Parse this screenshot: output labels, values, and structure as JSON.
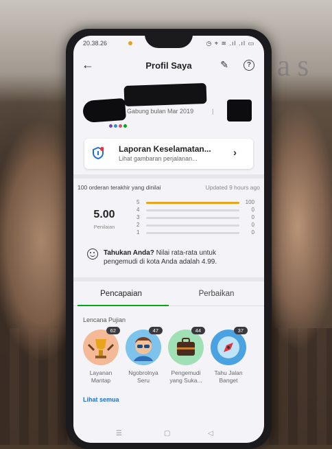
{
  "status": {
    "time": "20.38.26",
    "icons": "◷ ⌖ ≋ .ıl .ıl ▭"
  },
  "header": {
    "title": "Profil Saya",
    "back_icon": "←",
    "edit_icon": "✎",
    "help_icon": "?"
  },
  "profile": {
    "joined": "Gabung bulan Mar 2019",
    "separator": "|"
  },
  "safety_report": {
    "title": "Laporan Keselamatan...",
    "subtitle": "Lihat gambaran perjalanan...",
    "chevron": "›"
  },
  "ratings": {
    "header": "100 orderan terakhir yang dinilai",
    "updated": "Updated 9 hours ago",
    "score": "5.00",
    "score_label": "Penilaian",
    "distribution": [
      {
        "stars": "5",
        "count": "100",
        "fraction": 1.0
      },
      {
        "stars": "4",
        "count": "0",
        "fraction": 0
      },
      {
        "stars": "3",
        "count": "0",
        "fraction": 0
      },
      {
        "stars": "2",
        "count": "0",
        "fraction": 0
      },
      {
        "stars": "1",
        "count": "0",
        "fraction": 0
      }
    ],
    "tip_bold": "Tahukan Anda?",
    "tip_text": " Nilai rata-rata untuk pengemudi di kota Anda adalah 4.99."
  },
  "tabs": [
    {
      "label": "Pencapaian",
      "active": true
    },
    {
      "label": "Perbaikan",
      "active": false
    }
  ],
  "badges": {
    "title": "Lencana Pujian",
    "items": [
      {
        "count": "62",
        "label": "Layanan Mantap",
        "color": "#f4b996"
      },
      {
        "count": "47",
        "label": "Ngobrolnya Seru",
        "color": "#7ec3ec"
      },
      {
        "count": "44",
        "label": "Pengemudi yang Suka...",
        "color": "#9fe0b4"
      },
      {
        "count": "37",
        "label": "Tahu Jalan Banget",
        "color": "#4aa3e0"
      }
    ],
    "see_all": "Lihat semua"
  },
  "navbar": {
    "menu": "☰",
    "home": "▢",
    "back": "◁"
  },
  "colors": {
    "accent": "#00aa13",
    "star_fill": "#e8a41a",
    "link": "#1e6fd9"
  }
}
